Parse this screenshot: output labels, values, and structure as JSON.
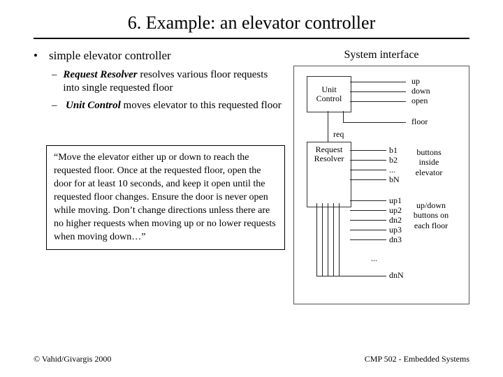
{
  "title": "6. Example: an elevator controller",
  "bullet": {
    "text": "simple elevator controller",
    "sub1_bold": "Request Resolver",
    "sub1_rest": " resolves various floor requests into single requested floor",
    "sub2_bold": "Unit Control",
    "sub2_rest": " moves elevator to this requested floor"
  },
  "quote": "“Move the elevator either up or down to reach the requested floor. Once at the requested floor, open the door for at least 10 seconds, and keep it open until the requested floor changes. Ensure the door is never open while moving. Don’t change directions unless there are no higher requests when moving up or no lower requests when moving down…”",
  "right_title": "System interface",
  "diagram": {
    "unit_control_l1": "Unit",
    "unit_control_l2": "Control",
    "req_resolver_l1": "Request",
    "req_resolver_l2": "Resolver",
    "signals_uc": [
      "up",
      "down",
      "open"
    ],
    "floor": "floor",
    "req": "req",
    "inside_btn": [
      "b1",
      "b2",
      "...",
      "bN"
    ],
    "inside_btn_note": "buttons inside elevator",
    "floor_btn": [
      "up1",
      "up2",
      "dn2",
      "up3",
      "dn3"
    ],
    "floor_btn_ell": "...",
    "floor_btn_last": "dnN",
    "floor_btn_note": "up/down buttons on each floor"
  },
  "footer_left": "© Vahid/Givargis 2000",
  "footer_right": "CMP 502 - Embedded Systems"
}
